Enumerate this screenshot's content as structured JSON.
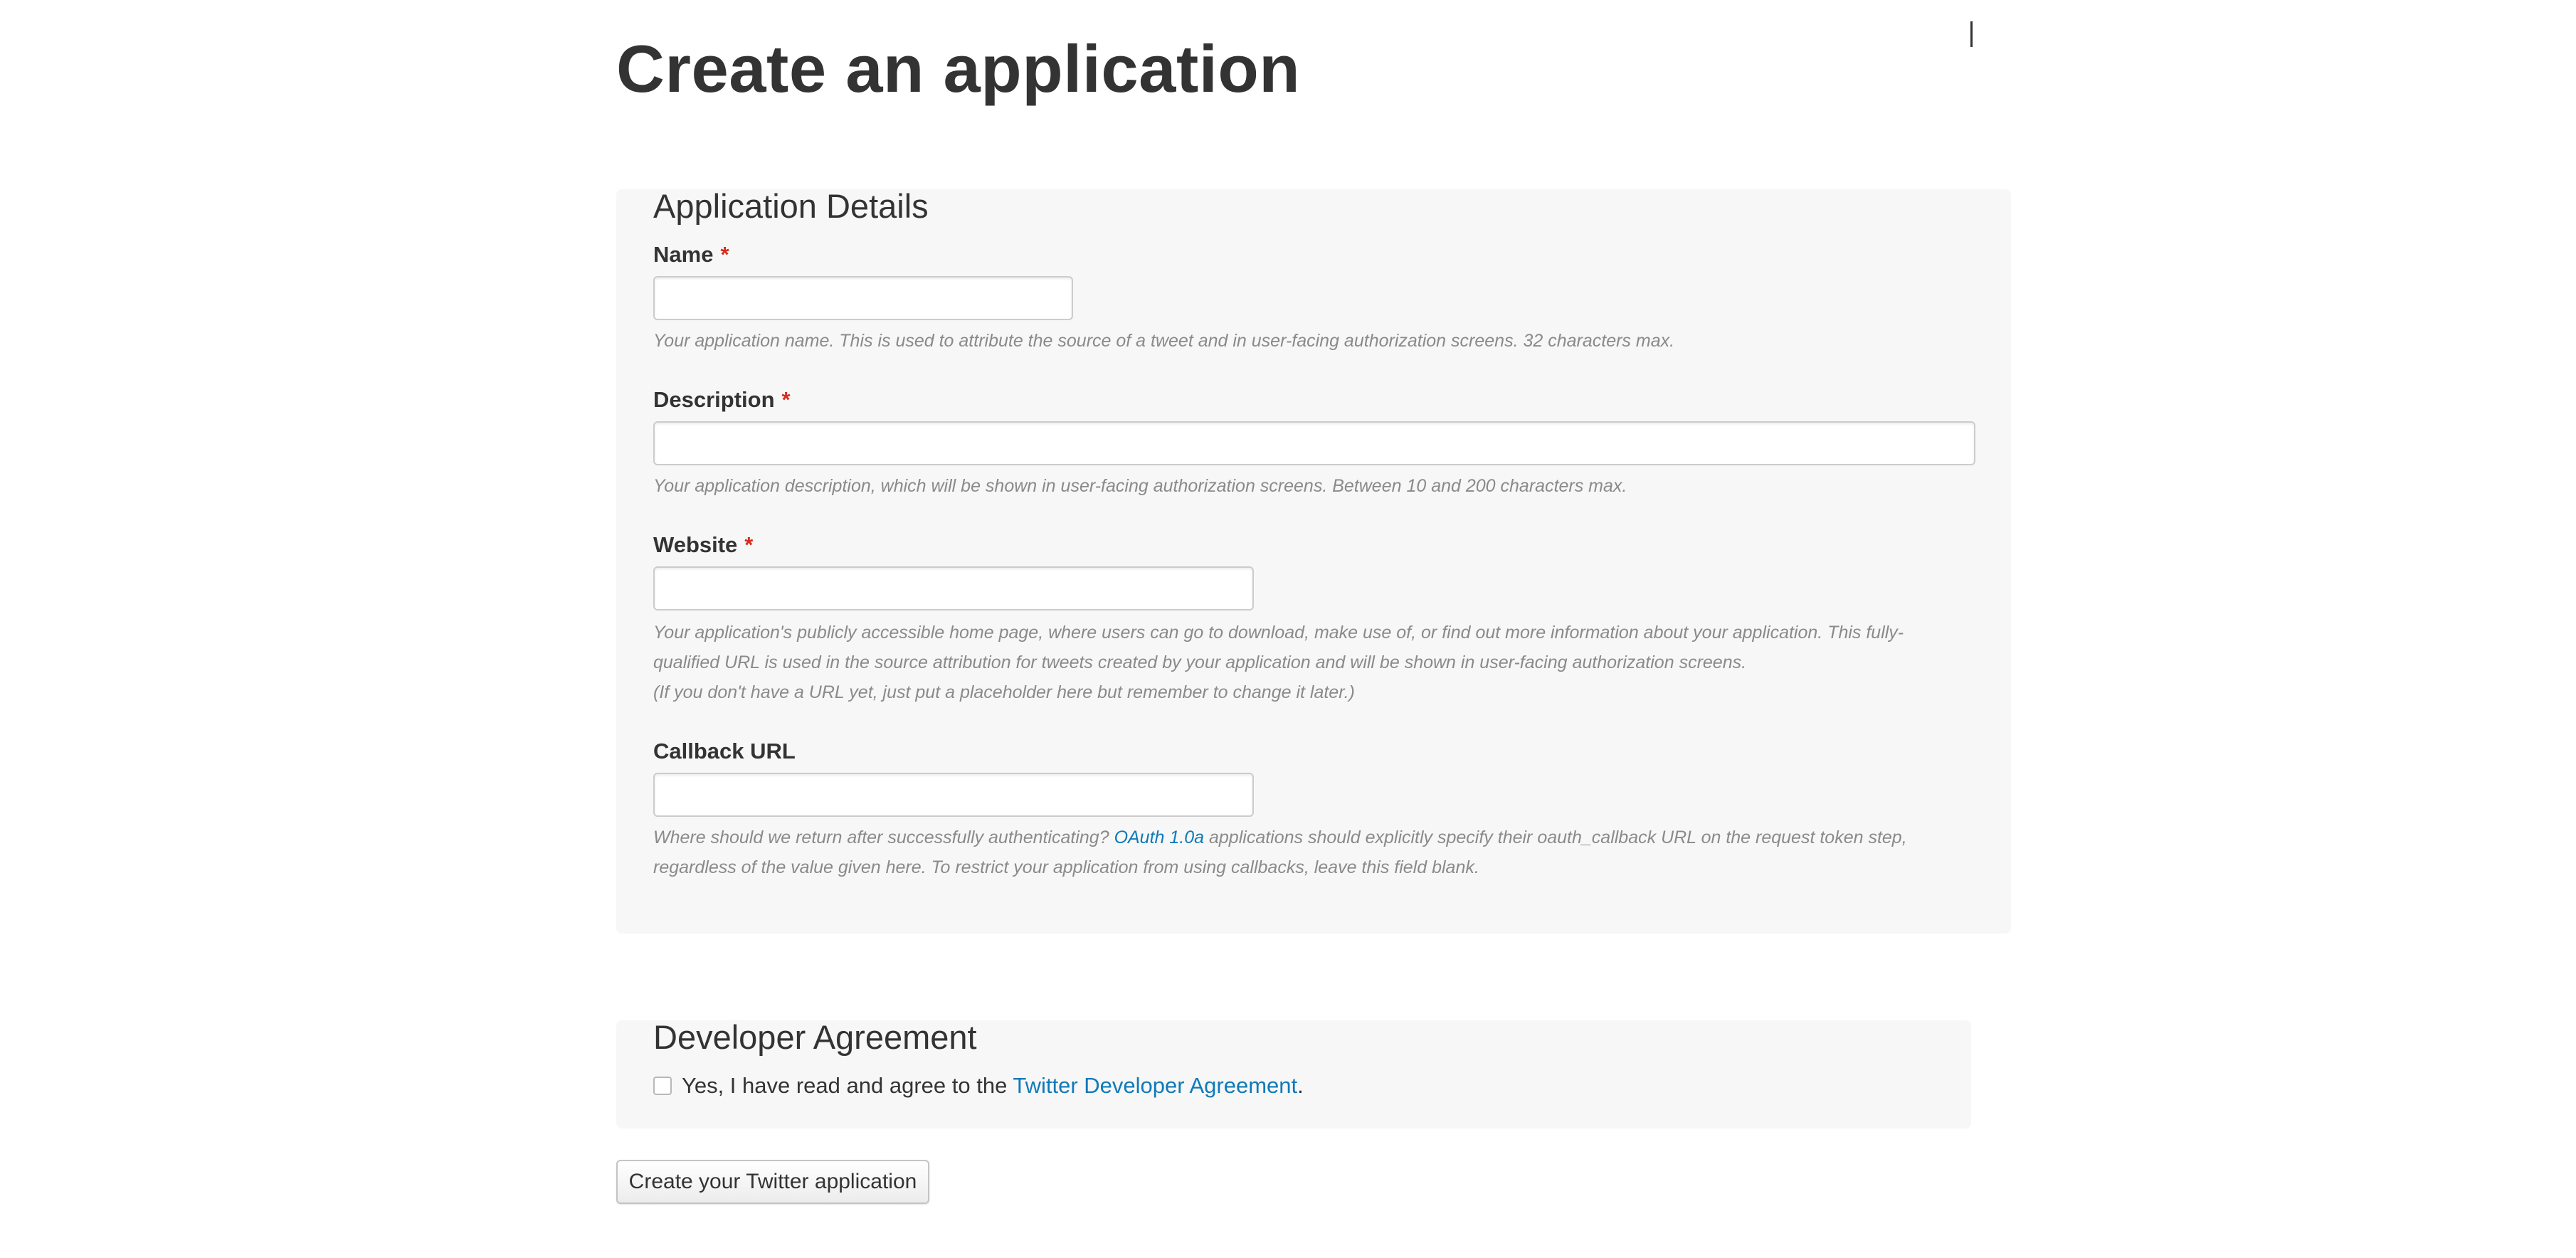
{
  "page": {
    "title": "Create an application"
  },
  "details": {
    "legend": "Application Details",
    "required_marker": "*",
    "name": {
      "label": "Name",
      "value": "",
      "hint": "Your application name. This is used to attribute the source of a tweet and in user-facing authorization screens. 32 characters max."
    },
    "description": {
      "label": "Description",
      "value": "",
      "hint": "Your application description, which will be shown in user-facing authorization screens. Between 10 and 200 characters max."
    },
    "website": {
      "label": "Website",
      "value": "",
      "hint_line1": "Your application's publicly accessible home page, where users can go to download, make use of, or find out more information about your application. This fully-qualified URL is used in the source attribution for tweets created by your application and will be shown in user-facing authorization screens.",
      "hint_line2": "(If you don't have a URL yet, just put a placeholder here but remember to change it later.)"
    },
    "callback": {
      "label": "Callback URL",
      "value": "",
      "hint_before_link": "Where should we return after successfully authenticating? ",
      "hint_link": "OAuth 1.0a",
      "hint_after_link": " applications should explicitly specify their oauth_callback URL on the request token step, regardless of the value given here. To restrict your application from using callbacks, leave this field blank."
    }
  },
  "agreement": {
    "legend": "Developer Agreement",
    "text_before_link": "Yes, I have read and agree to the ",
    "link_text": "Twitter Developer Agreement",
    "text_after_link": ".",
    "checked": false
  },
  "submit": {
    "label": "Create your Twitter application"
  },
  "colors": {
    "required_asterisk": "#d92a1e",
    "link": "#0f7ab8",
    "panel_background": "#f7f7f7"
  }
}
